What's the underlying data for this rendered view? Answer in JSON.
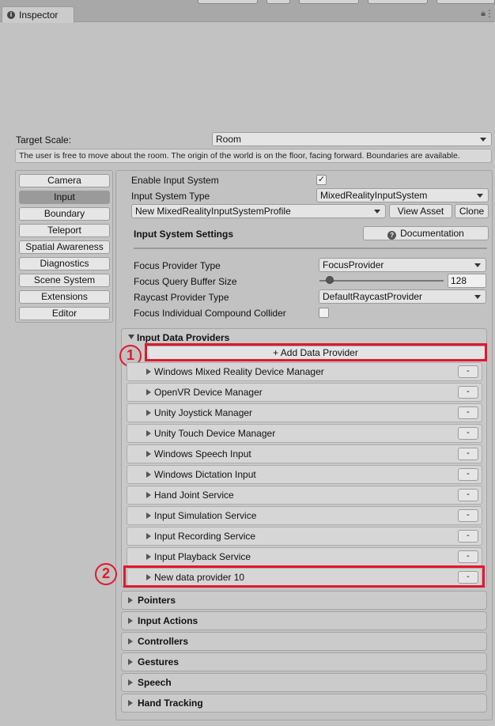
{
  "tab": {
    "title": "Inspector"
  },
  "target_scale": {
    "label": "Target Scale:",
    "value": "Room",
    "help": "The user is free to move about the room. The origin of the world is on the floor, facing forward. Boundaries are available."
  },
  "sidebar": {
    "items": [
      "Camera",
      "Input",
      "Boundary",
      "Teleport",
      "Spatial Awareness",
      "Diagnostics",
      "Scene System",
      "Extensions",
      "Editor"
    ],
    "active": "Input"
  },
  "input": {
    "enable_label": "Enable Input System",
    "enable_checked": "✓",
    "type_label": "Input System Type",
    "type_value": "MixedRealityInputSystem",
    "profile_value": "New MixedRealityInputSystemProfile",
    "view_asset_label": "View Asset",
    "clone_label": "Clone",
    "settings_title": "Input System Settings",
    "documentation_label": "Documentation",
    "focus_provider_label": "Focus Provider Type",
    "focus_provider_value": "FocusProvider",
    "focus_buffer_label": "Focus Query Buffer Size",
    "focus_buffer_value": "128",
    "focus_buffer_fraction": 0.08,
    "raycast_label": "Raycast Provider Type",
    "raycast_value": "DefaultRaycastProvider",
    "compound_label": "Focus Individual Compound Collider"
  },
  "data_providers": {
    "title": "Input Data Providers",
    "add_label": "+ Add Data Provider",
    "remove_label": "-",
    "items": [
      "Windows Mixed Reality Device Manager",
      "OpenVR Device Manager",
      "Unity Joystick Manager",
      "Unity Touch Device Manager",
      "Windows Speech Input",
      "Windows Dictation Input",
      "Hand Joint Service",
      "Input Simulation Service",
      "Input Recording Service",
      "Input Playback Service",
      "New data provider 10"
    ]
  },
  "sections": [
    "Pointers",
    "Input Actions",
    "Controllers",
    "Gestures",
    "Speech",
    "Hand Tracking"
  ],
  "annotations": {
    "first": "1",
    "second": "2"
  },
  "colors": {
    "highlight": "#e0192c",
    "active_tab": "#9a9a9a"
  }
}
